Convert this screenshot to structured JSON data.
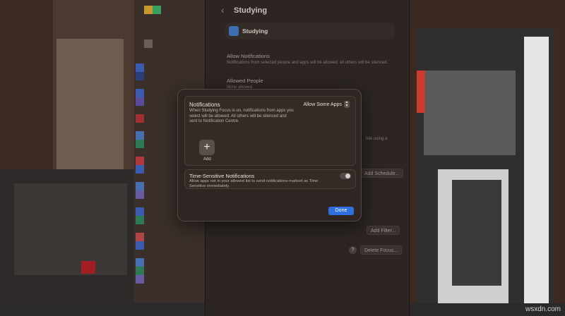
{
  "settings_window": {
    "title": "Studying",
    "focus_name": "Studying",
    "allow_notifications": {
      "title": "Allow Notifications",
      "description": "Notifications from selected people and apps will be allowed; all others will be silenced."
    },
    "allowed_people": {
      "title": "Allowed People",
      "subtitle": "None allowed"
    },
    "partial_schedule_text": "hile using a",
    "add_schedule_label": "Add Schedule...",
    "add_filter_label": "Add Filter...",
    "delete_focus_label": "Delete Focus...",
    "help_label": "?"
  },
  "modal": {
    "notifications": {
      "title": "Notifications",
      "description": "When Studying  Focus is on, notifications from apps you select will be allowed. All others will be silenced and sent to Notification Centre.",
      "selected_option": "Allow Some Apps",
      "add_label": "Add"
    },
    "time_sensitive": {
      "title": "Time-Sensitive Notifications",
      "description": "Allow apps not in your allowed list to send notifications marked as Time Sensitive immediately.",
      "enabled": false
    },
    "done_label": "Done"
  },
  "watermark": "wsxdn.com",
  "colors": {
    "accent": "#2f6fe0",
    "modal_bg": "#2f2623",
    "window_bg": "#2c2522",
    "focus_icon": "#3c6fb4"
  }
}
